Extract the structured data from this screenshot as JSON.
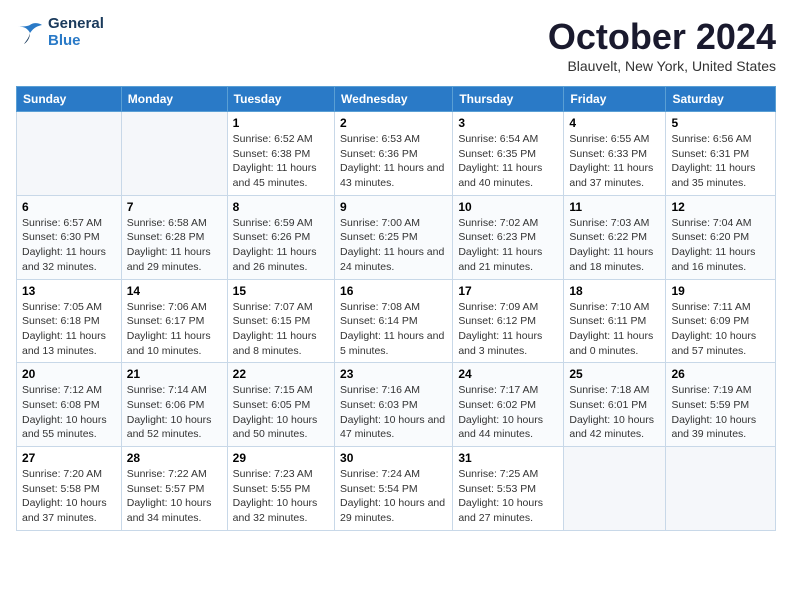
{
  "header": {
    "logo_line1": "General",
    "logo_line2": "Blue",
    "title": "October 2024",
    "subtitle": "Blauvelt, New York, United States"
  },
  "weekdays": [
    "Sunday",
    "Monday",
    "Tuesday",
    "Wednesday",
    "Thursday",
    "Friday",
    "Saturday"
  ],
  "weeks": [
    [
      {
        "day": "",
        "info": ""
      },
      {
        "day": "",
        "info": ""
      },
      {
        "day": "1",
        "info": "Sunrise: 6:52 AM\nSunset: 6:38 PM\nDaylight: 11 hours and 45 minutes."
      },
      {
        "day": "2",
        "info": "Sunrise: 6:53 AM\nSunset: 6:36 PM\nDaylight: 11 hours and 43 minutes."
      },
      {
        "day": "3",
        "info": "Sunrise: 6:54 AM\nSunset: 6:35 PM\nDaylight: 11 hours and 40 minutes."
      },
      {
        "day": "4",
        "info": "Sunrise: 6:55 AM\nSunset: 6:33 PM\nDaylight: 11 hours and 37 minutes."
      },
      {
        "day": "5",
        "info": "Sunrise: 6:56 AM\nSunset: 6:31 PM\nDaylight: 11 hours and 35 minutes."
      }
    ],
    [
      {
        "day": "6",
        "info": "Sunrise: 6:57 AM\nSunset: 6:30 PM\nDaylight: 11 hours and 32 minutes."
      },
      {
        "day": "7",
        "info": "Sunrise: 6:58 AM\nSunset: 6:28 PM\nDaylight: 11 hours and 29 minutes."
      },
      {
        "day": "8",
        "info": "Sunrise: 6:59 AM\nSunset: 6:26 PM\nDaylight: 11 hours and 26 minutes."
      },
      {
        "day": "9",
        "info": "Sunrise: 7:00 AM\nSunset: 6:25 PM\nDaylight: 11 hours and 24 minutes."
      },
      {
        "day": "10",
        "info": "Sunrise: 7:02 AM\nSunset: 6:23 PM\nDaylight: 11 hours and 21 minutes."
      },
      {
        "day": "11",
        "info": "Sunrise: 7:03 AM\nSunset: 6:22 PM\nDaylight: 11 hours and 18 minutes."
      },
      {
        "day": "12",
        "info": "Sunrise: 7:04 AM\nSunset: 6:20 PM\nDaylight: 11 hours and 16 minutes."
      }
    ],
    [
      {
        "day": "13",
        "info": "Sunrise: 7:05 AM\nSunset: 6:18 PM\nDaylight: 11 hours and 13 minutes."
      },
      {
        "day": "14",
        "info": "Sunrise: 7:06 AM\nSunset: 6:17 PM\nDaylight: 11 hours and 10 minutes."
      },
      {
        "day": "15",
        "info": "Sunrise: 7:07 AM\nSunset: 6:15 PM\nDaylight: 11 hours and 8 minutes."
      },
      {
        "day": "16",
        "info": "Sunrise: 7:08 AM\nSunset: 6:14 PM\nDaylight: 11 hours and 5 minutes."
      },
      {
        "day": "17",
        "info": "Sunrise: 7:09 AM\nSunset: 6:12 PM\nDaylight: 11 hours and 3 minutes."
      },
      {
        "day": "18",
        "info": "Sunrise: 7:10 AM\nSunset: 6:11 PM\nDaylight: 11 hours and 0 minutes."
      },
      {
        "day": "19",
        "info": "Sunrise: 7:11 AM\nSunset: 6:09 PM\nDaylight: 10 hours and 57 minutes."
      }
    ],
    [
      {
        "day": "20",
        "info": "Sunrise: 7:12 AM\nSunset: 6:08 PM\nDaylight: 10 hours and 55 minutes."
      },
      {
        "day": "21",
        "info": "Sunrise: 7:14 AM\nSunset: 6:06 PM\nDaylight: 10 hours and 52 minutes."
      },
      {
        "day": "22",
        "info": "Sunrise: 7:15 AM\nSunset: 6:05 PM\nDaylight: 10 hours and 50 minutes."
      },
      {
        "day": "23",
        "info": "Sunrise: 7:16 AM\nSunset: 6:03 PM\nDaylight: 10 hours and 47 minutes."
      },
      {
        "day": "24",
        "info": "Sunrise: 7:17 AM\nSunset: 6:02 PM\nDaylight: 10 hours and 44 minutes."
      },
      {
        "day": "25",
        "info": "Sunrise: 7:18 AM\nSunset: 6:01 PM\nDaylight: 10 hours and 42 minutes."
      },
      {
        "day": "26",
        "info": "Sunrise: 7:19 AM\nSunset: 5:59 PM\nDaylight: 10 hours and 39 minutes."
      }
    ],
    [
      {
        "day": "27",
        "info": "Sunrise: 7:20 AM\nSunset: 5:58 PM\nDaylight: 10 hours and 37 minutes."
      },
      {
        "day": "28",
        "info": "Sunrise: 7:22 AM\nSunset: 5:57 PM\nDaylight: 10 hours and 34 minutes."
      },
      {
        "day": "29",
        "info": "Sunrise: 7:23 AM\nSunset: 5:55 PM\nDaylight: 10 hours and 32 minutes."
      },
      {
        "day": "30",
        "info": "Sunrise: 7:24 AM\nSunset: 5:54 PM\nDaylight: 10 hours and 29 minutes."
      },
      {
        "day": "31",
        "info": "Sunrise: 7:25 AM\nSunset: 5:53 PM\nDaylight: 10 hours and 27 minutes."
      },
      {
        "day": "",
        "info": ""
      },
      {
        "day": "",
        "info": ""
      }
    ]
  ]
}
